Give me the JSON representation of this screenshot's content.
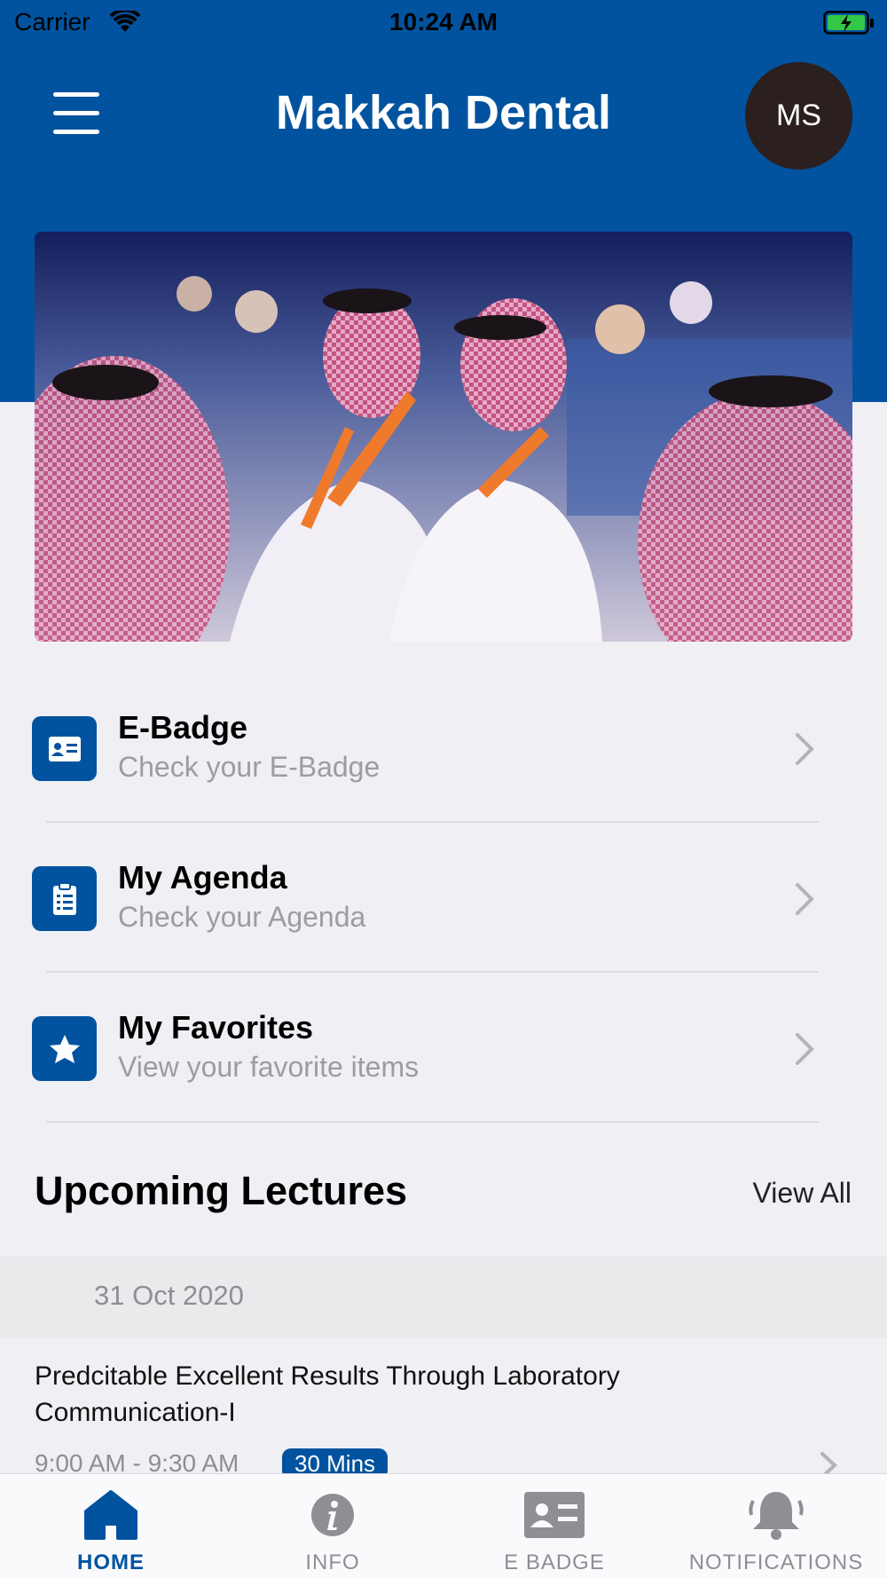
{
  "status_bar": {
    "carrier": "Carrier",
    "time": "10:24 AM"
  },
  "header": {
    "title": "Makkah Dental",
    "avatar_initials": "MS"
  },
  "menu": [
    {
      "title": "E-Badge",
      "subtitle": "Check your E-Badge",
      "icon": "id-card-icon"
    },
    {
      "title": "My Agenda",
      "subtitle": "Check your Agenda",
      "icon": "clipboard-icon"
    },
    {
      "title": "My Favorites",
      "subtitle": "View your favorite items",
      "icon": "star-icon"
    }
  ],
  "lectures": {
    "section_title": "Upcoming Lectures",
    "view_all": "View All",
    "date": "31 Oct 2020",
    "items": [
      {
        "title": "Predcitable Excellent Results Through Laboratory Communication-I",
        "time": "9:00 AM - 9:30 AM",
        "duration": "30 Mins"
      }
    ]
  },
  "tabs": [
    {
      "label": "HOME",
      "icon": "home-icon",
      "active": true
    },
    {
      "label": "INFO",
      "icon": "info-icon",
      "active": false
    },
    {
      "label": "E BADGE",
      "icon": "id-card-icon",
      "active": false
    },
    {
      "label": "NOTIFICATIONS",
      "icon": "bell-icon",
      "active": false
    }
  ],
  "colors": {
    "brand_blue": "#01539f",
    "background": "#efeff4",
    "avatar_bg": "#2b1f1f"
  }
}
